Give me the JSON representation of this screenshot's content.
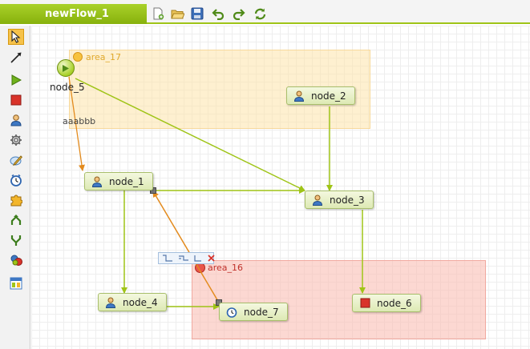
{
  "tab": {
    "title": "newFlow_1"
  },
  "toolbar": {
    "buttons": [
      {
        "name": "new-file"
      },
      {
        "name": "open-folder"
      },
      {
        "name": "save"
      },
      {
        "name": "undo"
      },
      {
        "name": "redo"
      },
      {
        "name": "refresh"
      }
    ]
  },
  "palette": {
    "items": [
      {
        "name": "select-tool",
        "selected": true
      },
      {
        "name": "connection-tool"
      },
      {
        "name": "start-node-tool"
      },
      {
        "name": "end-node-tool"
      },
      {
        "name": "human-task-tool"
      },
      {
        "name": "service-task-tool"
      },
      {
        "name": "script-task-tool"
      },
      {
        "name": "timer-tool"
      },
      {
        "name": "subprocess-tool"
      },
      {
        "name": "gateway-join-tool"
      },
      {
        "name": "gateway-split-tool"
      },
      {
        "name": "multi-instance-tool"
      },
      {
        "name": "swimlane-tool"
      }
    ]
  },
  "areas": {
    "area_17": {
      "label": "area_17",
      "color": "#f5b731"
    },
    "area_16": {
      "label": "area_16",
      "color": "#e9554a"
    }
  },
  "start": {
    "label": "node_5"
  },
  "edge_label": "aaabbb",
  "nodes": {
    "node_1": {
      "label": "node_1",
      "icon": "user-icon"
    },
    "node_2": {
      "label": "node_2",
      "icon": "user-icon"
    },
    "node_3": {
      "label": "node_3",
      "icon": "user-icon"
    },
    "node_4": {
      "label": "node_4",
      "icon": "user-icon"
    },
    "node_6": {
      "label": "node_6",
      "icon": "end-icon"
    },
    "node_7": {
      "label": "node_7",
      "icon": "timer-icon"
    }
  },
  "colors": {
    "accent": "#9fc417",
    "edge": "#9fc417",
    "selected_edge": "#e38b1e"
  }
}
